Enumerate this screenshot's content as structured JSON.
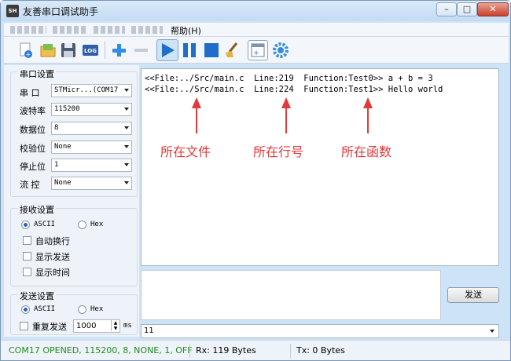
{
  "window": {
    "title": "友善串口调试助手",
    "app_icon_text": "SH"
  },
  "menu": {
    "help_label": "帮助(H)"
  },
  "toolbar": {
    "items": [
      "new-icon",
      "open-icon",
      "save-icon",
      "log-icon",
      "add-icon",
      "remove-icon",
      "play-icon",
      "pause-icon",
      "stop-icon",
      "clear-icon",
      "window-icon",
      "settings-icon"
    ],
    "log_label": "LOG"
  },
  "serial_settings": {
    "title": "串口设置",
    "port": {
      "label": "串  口",
      "value": "STMicr...(COM17"
    },
    "baud": {
      "label": "波特率",
      "value": "115200"
    },
    "data_bits": {
      "label": "数据位",
      "value": "8"
    },
    "parity": {
      "label": "校验位",
      "value": "None"
    },
    "stop_bits": {
      "label": "停止位",
      "value": "1"
    },
    "flow": {
      "label": "流  控",
      "value": "None"
    }
  },
  "receive_settings": {
    "title": "接收设置",
    "ascii_label": "ASCII",
    "hex_label": "Hex",
    "selected": "ASCII",
    "options": [
      {
        "label": "自动换行",
        "checked": false
      },
      {
        "label": "显示发送",
        "checked": false
      },
      {
        "label": "显示时间",
        "checked": false
      }
    ]
  },
  "send_settings": {
    "title": "发送设置",
    "ascii_label": "ASCII",
    "hex_label": "Hex",
    "selected": "ASCII",
    "repeat_label": "重复发送",
    "repeat_checked": false,
    "interval_value": "1000",
    "interval_unit": "ms"
  },
  "receive_area": {
    "lines": [
      "<<File:../Src/main.c  Line:219  Function:Test0>> a + b = 3",
      "<<File:../Src/main.c  Line:224  Function:Test1>> Hello world"
    ]
  },
  "annotations": [
    {
      "text": "所在文件"
    },
    {
      "text": "所在行号"
    },
    {
      "text": "所在函数"
    }
  ],
  "annotation_color": "#e03a3a",
  "send_button_label": "发送",
  "history_value": "11",
  "status": {
    "port_state": "COM17 OPENED, 115200, 8, NONE, 1, OFF",
    "rx": "Rx: 119 Bytes",
    "tx": "Tx: 0 Bytes",
    "port_state_color": "#1f8a1f"
  }
}
